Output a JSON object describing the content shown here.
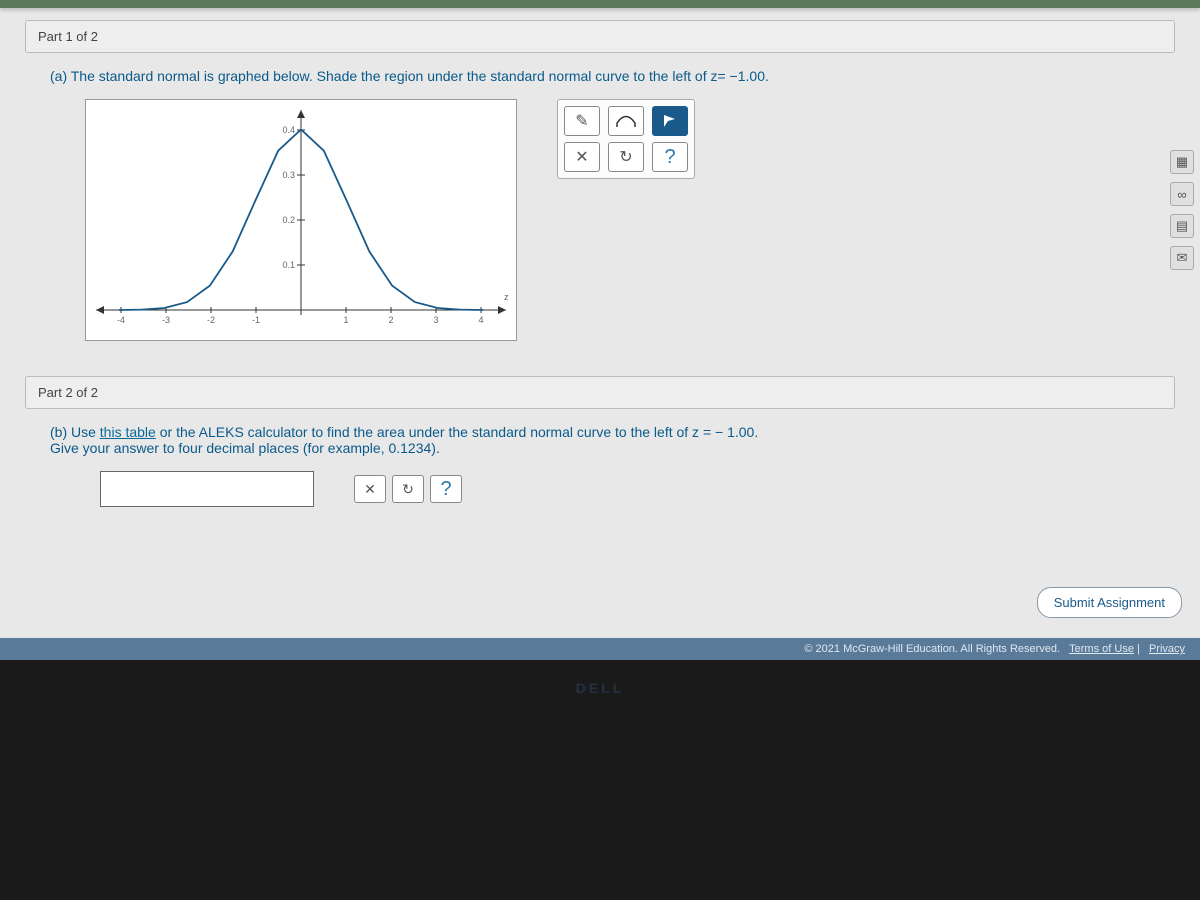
{
  "part1": {
    "header": "Part 1 of 2",
    "question_prefix": "(a) The standard normal is graphed below. Shade the region under the standard normal curve to the left of z",
    "question_eq": "= −1.00.",
    "toolbar": {
      "pencil": "✎",
      "fill_left": "◠",
      "flag": "◤",
      "clear": "✕",
      "reset": "↻",
      "help": "?"
    }
  },
  "part2": {
    "header": "Part 2 of 2",
    "question_b_prefix": "(b) Use ",
    "table_link": "this table",
    "question_b_mid": " or the ALEKS calculator to find the area under the standard normal curve to the left of z = − 1.00.",
    "question_b_line2": "Give your answer to four decimal places (for example, 0.1234).",
    "input_value": "",
    "toolbar": {
      "clear": "✕",
      "reset": "↻",
      "help": "?"
    }
  },
  "sidebar": {
    "calc": "▦",
    "infinity": "∞",
    "notes": "▤",
    "mail": "✉"
  },
  "submit_label": "Submit Assignment",
  "footer": {
    "copyright": "© 2021 McGraw-Hill Education. All Rights Reserved.",
    "terms": "Terms of Use",
    "privacy": "Privacy"
  },
  "brand": "DELL",
  "chart_data": {
    "type": "line",
    "title": "",
    "xlabel": "z",
    "ylabel": "",
    "xlim": [
      -4.5,
      4.5
    ],
    "ylim": [
      0,
      0.42
    ],
    "x_ticks": [
      -4,
      -3,
      -2,
      -1,
      0,
      1,
      2,
      3,
      4
    ],
    "y_ticks": [
      0.1,
      0.2,
      0.3,
      0.4
    ],
    "series": [
      {
        "name": "standard_normal_pdf",
        "x": [
          -4.0,
          -3.5,
          -3.0,
          -2.5,
          -2.0,
          -1.5,
          -1.0,
          -0.5,
          0.0,
          0.5,
          1.0,
          1.5,
          2.0,
          2.5,
          3.0,
          3.5,
          4.0
        ],
        "values": [
          0.0001,
          0.0009,
          0.0044,
          0.0175,
          0.054,
          0.1295,
          0.242,
          0.3521,
          0.3989,
          0.3521,
          0.242,
          0.1295,
          0.054,
          0.0175,
          0.0044,
          0.0009,
          0.0001
        ]
      }
    ]
  }
}
